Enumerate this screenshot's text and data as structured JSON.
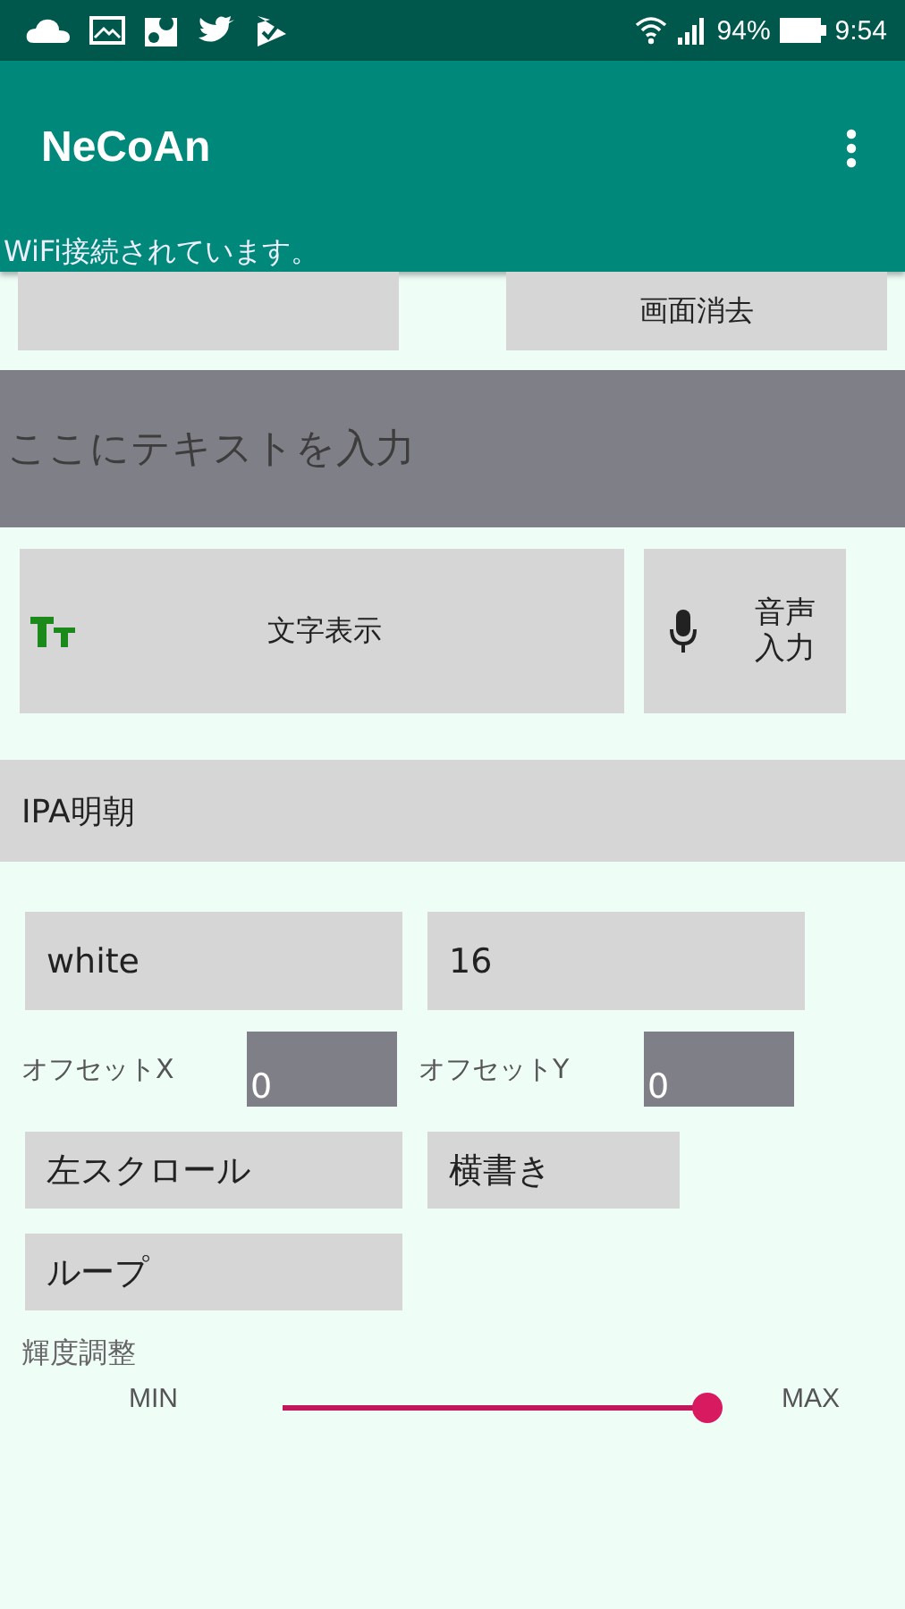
{
  "status_bar": {
    "battery": "94%",
    "time": "9:54"
  },
  "app_bar": {
    "title": "NeCoAn"
  },
  "toast": "WiFi接続されています。",
  "top_buttons": [
    {
      "label": "画面消去"
    }
  ],
  "text_input": {
    "placeholder": "ここにテキストを入力"
  },
  "action_buttons": [
    {
      "kind": "text",
      "label": "文字表示"
    },
    {
      "kind": "mic",
      "label": "音声入力"
    }
  ],
  "font_dropdown": {
    "value": "IPA明朝"
  },
  "color_field": {
    "value": "white"
  },
  "size_field": {
    "value": "16"
  },
  "offsets": [
    {
      "label": "オフセットX",
      "value": "0"
    },
    {
      "label": "オフセットY",
      "value": "0"
    }
  ],
  "mode_buttons": [
    {
      "label": "左スクロール"
    },
    {
      "label": "横書き"
    }
  ],
  "loop_button": {
    "label": "ループ"
  },
  "brightness": {
    "label": "輝度調整",
    "min_label": "MIN",
    "max_label": "MAX",
    "level": 1
  }
}
